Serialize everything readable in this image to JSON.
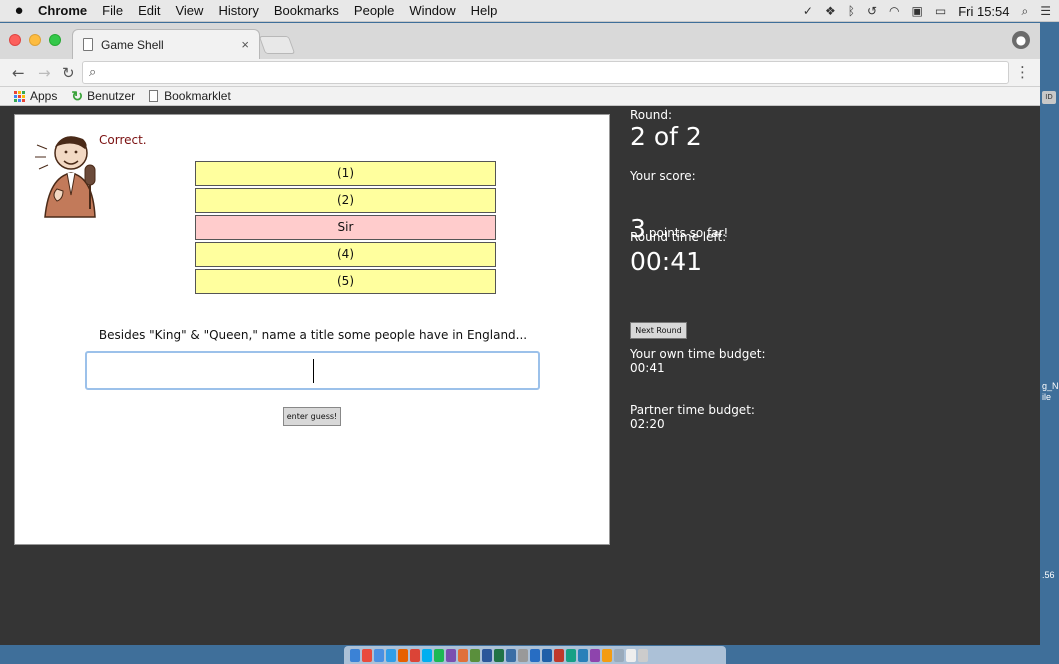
{
  "menubar": {
    "apple": "",
    "app": "Chrome",
    "items": [
      "File",
      "Edit",
      "View",
      "History",
      "Bookmarks",
      "People",
      "Window",
      "Help"
    ],
    "clock": "Fri 15:54"
  },
  "browser": {
    "tab_title": "Game Shell",
    "tab_close": "×",
    "address": "",
    "bookmarks": {
      "apps": "Apps",
      "benutzer": "Benutzer",
      "bookmarklet": "Bookmarklet"
    }
  },
  "game": {
    "feedback": "Correct.",
    "answers": [
      {
        "label": "(1)",
        "revealed": false
      },
      {
        "label": "(2)",
        "revealed": false
      },
      {
        "label": "Sir",
        "revealed": true
      },
      {
        "label": "(4)",
        "revealed": false
      },
      {
        "label": "(5)",
        "revealed": false
      }
    ],
    "question": "Besides \"King\" & \"Queen,\" name a title some people have in England...",
    "guess_value": "",
    "guess_button": "enter guess!"
  },
  "sidebar": {
    "round_label": "Round:",
    "round_value": "2 of 2",
    "score_label": "Your score:",
    "score_value": "3",
    "score_suffix": "points so far!",
    "time_label": "Round time left:",
    "time_value": "00:41",
    "next_button": "Next Round",
    "own_budget_label": "Your own time budget:",
    "own_budget_value": "00:41",
    "partner_budget_label": "Partner time budget:",
    "partner_budget_value": "02:20"
  },
  "desktop": {
    "frag1": "ID",
    "frag2": "g_N",
    "frag3": "ile",
    "frag4": ".56"
  },
  "colors": {
    "answer_hidden": "#ffff9e",
    "answer_revealed": "#ffcccc",
    "feedback": "#7a1010",
    "page_bg": "#353535"
  }
}
